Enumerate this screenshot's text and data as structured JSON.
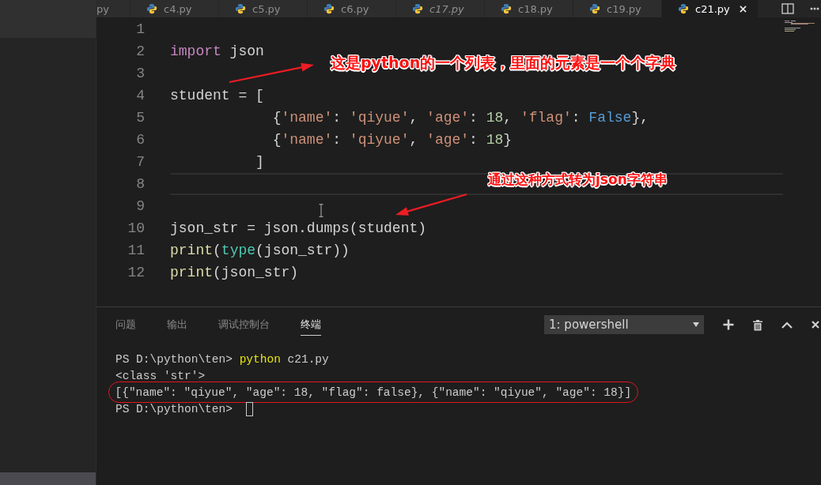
{
  "editor_tabs": [
    {
      "kind": "clipped",
      "label": "py",
      "selected": false,
      "preview": false
    },
    {
      "kind": "file",
      "label": "c4.py",
      "selected": false,
      "preview": false
    },
    {
      "kind": "file",
      "label": "c5.py",
      "selected": false,
      "preview": false
    },
    {
      "kind": "file",
      "label": "c6.py",
      "selected": false,
      "preview": false
    },
    {
      "kind": "file",
      "label": "c17.py",
      "selected": false,
      "preview": true
    },
    {
      "kind": "file",
      "label": "c18.py",
      "selected": false,
      "preview": false
    },
    {
      "kind": "file",
      "label": "c19.py",
      "selected": false,
      "preview": false
    },
    {
      "kind": "file",
      "label": "c21.py",
      "selected": true,
      "preview": false
    }
  ],
  "editor": {
    "lines": [
      {
        "number": "1",
        "current": false
      },
      {
        "number": "2",
        "current": false,
        "tokens": [
          {
            "kind": "keyword",
            "text": "import"
          },
          {
            "kind": "plain",
            "text": " json"
          }
        ]
      },
      {
        "number": "3",
        "current": false
      },
      {
        "number": "4",
        "current": false,
        "tokens": [
          {
            "kind": "plain",
            "text": "student = ["
          }
        ]
      },
      {
        "number": "5",
        "current": false,
        "tokens": [
          {
            "kind": "plain",
            "text": "            {"
          },
          {
            "kind": "string",
            "text": "'name'"
          },
          {
            "kind": "plain",
            "text": ": "
          },
          {
            "kind": "string",
            "text": "'qiyue'"
          },
          {
            "kind": "plain",
            "text": ", "
          },
          {
            "kind": "string",
            "text": "'age'"
          },
          {
            "kind": "plain",
            "text": ": "
          },
          {
            "kind": "number",
            "text": "18"
          },
          {
            "kind": "plain",
            "text": ", "
          },
          {
            "kind": "string",
            "text": "'flag'"
          },
          {
            "kind": "plain",
            "text": ": "
          },
          {
            "kind": "constant",
            "text": "False"
          },
          {
            "kind": "plain",
            "text": "},"
          }
        ]
      },
      {
        "number": "6",
        "current": false,
        "tokens": [
          {
            "kind": "plain",
            "text": "            {"
          },
          {
            "kind": "string",
            "text": "'name'"
          },
          {
            "kind": "plain",
            "text": ": "
          },
          {
            "kind": "string",
            "text": "'qiyue'"
          },
          {
            "kind": "plain",
            "text": ", "
          },
          {
            "kind": "string",
            "text": "'age'"
          },
          {
            "kind": "plain",
            "text": ": "
          },
          {
            "kind": "number",
            "text": "18"
          },
          {
            "kind": "plain",
            "text": "}"
          }
        ]
      },
      {
        "number": "7",
        "current": false,
        "tokens": [
          {
            "kind": "plain",
            "text": "          ]"
          }
        ]
      },
      {
        "number": "8",
        "current": true
      },
      {
        "number": "9",
        "current": false
      },
      {
        "number": "10",
        "current": false,
        "tokens": [
          {
            "kind": "plain",
            "text": "json_str = json.dumps(student)"
          }
        ]
      },
      {
        "number": "11",
        "current": false,
        "tokens": [
          {
            "kind": "function",
            "text": "print"
          },
          {
            "kind": "plain",
            "text": "("
          },
          {
            "kind": "builtin",
            "text": "type"
          },
          {
            "kind": "plain",
            "text": "(json_str))"
          }
        ]
      },
      {
        "number": "12",
        "current": false,
        "tokens": [
          {
            "kind": "function",
            "text": "print"
          },
          {
            "kind": "plain",
            "text": "(json_str)"
          }
        ]
      }
    ]
  },
  "annotations": [
    {
      "text": "这是python的一个列表，里面的元素是一个个字典"
    },
    {
      "text": "通过这种方式转为json字符串"
    }
  ],
  "panel": {
    "tabs": [
      {
        "label": "问题",
        "selected": false
      },
      {
        "label": "输出",
        "selected": false
      },
      {
        "label": "调试控制台",
        "selected": false
      },
      {
        "label": "终端",
        "selected": true
      }
    ],
    "terminal_select": {
      "value": "1: powershell"
    },
    "terminal": {
      "lines": [
        {
          "circled": false,
          "cursor": false,
          "segments": [
            {
              "kind": "prompt",
              "text": "PS D:\\python\\ten> "
            },
            {
              "kind": "command",
              "text": "python"
            },
            {
              "kind": "output",
              "text": " c21.py"
            }
          ]
        },
        {
          "circled": false,
          "cursor": false,
          "segments": [
            {
              "kind": "output",
              "text": "<class 'str'>"
            }
          ]
        },
        {
          "circled": true,
          "cursor": false,
          "segments": [
            {
              "kind": "output",
              "text": "[{\"name\": \"qiyue\", \"age\": 18, \"flag\": false}, {\"name\": \"qiyue\", \"age\": 18}]"
            }
          ]
        },
        {
          "circled": false,
          "cursor": true,
          "segments": [
            {
              "kind": "prompt",
              "text": "PS D:\\python\\ten>"
            }
          ]
        }
      ]
    }
  }
}
